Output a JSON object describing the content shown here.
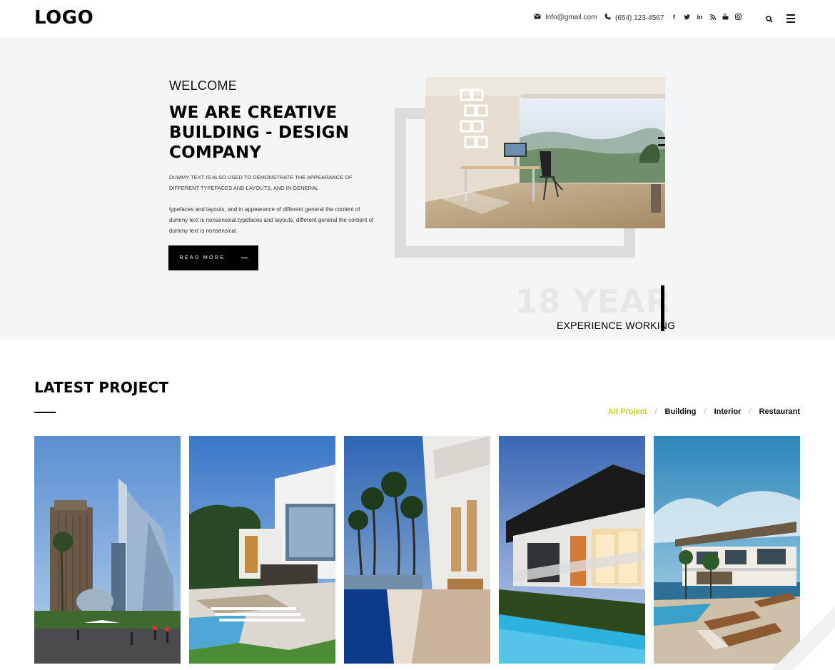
{
  "header": {
    "logo": "LOGO",
    "email": "Info@gmail.com",
    "phone": "(654) 123-4567",
    "social_icons": [
      "facebook-icon",
      "twitter-icon",
      "linkedin-icon",
      "rss-icon",
      "youtube-icon",
      "instagram-icon"
    ],
    "search_icon": "search-icon",
    "menu_icon": "menu-icon"
  },
  "hero": {
    "welcome": "WELCOME",
    "title": "WE ARE CREATIVE BUILDING - DESIGN COMPANY",
    "caps_text": "DUMMY TEXT IS ALSO USED TO DEMONSTRATE THE APPEARANCE OF DIFFERENT TYPEFACES AND LAYOUTS, AND IN GENERAL",
    "body_text": "typefaces and layouts, and in appearance of different general the content of dummy text is nonsensical.typefaces and layouts, different general the content of dummy text is nonsensical.",
    "button_label": "READ MORE",
    "years": "18 YEAR",
    "experience": "EXPERIENCE WORKING"
  },
  "projects": {
    "title": "LATEST PROJECT",
    "filters": [
      "All Project",
      "Building",
      "Interior",
      "Restaurant"
    ],
    "active_filter": "All Project",
    "accent_color": "#c8d41f"
  }
}
